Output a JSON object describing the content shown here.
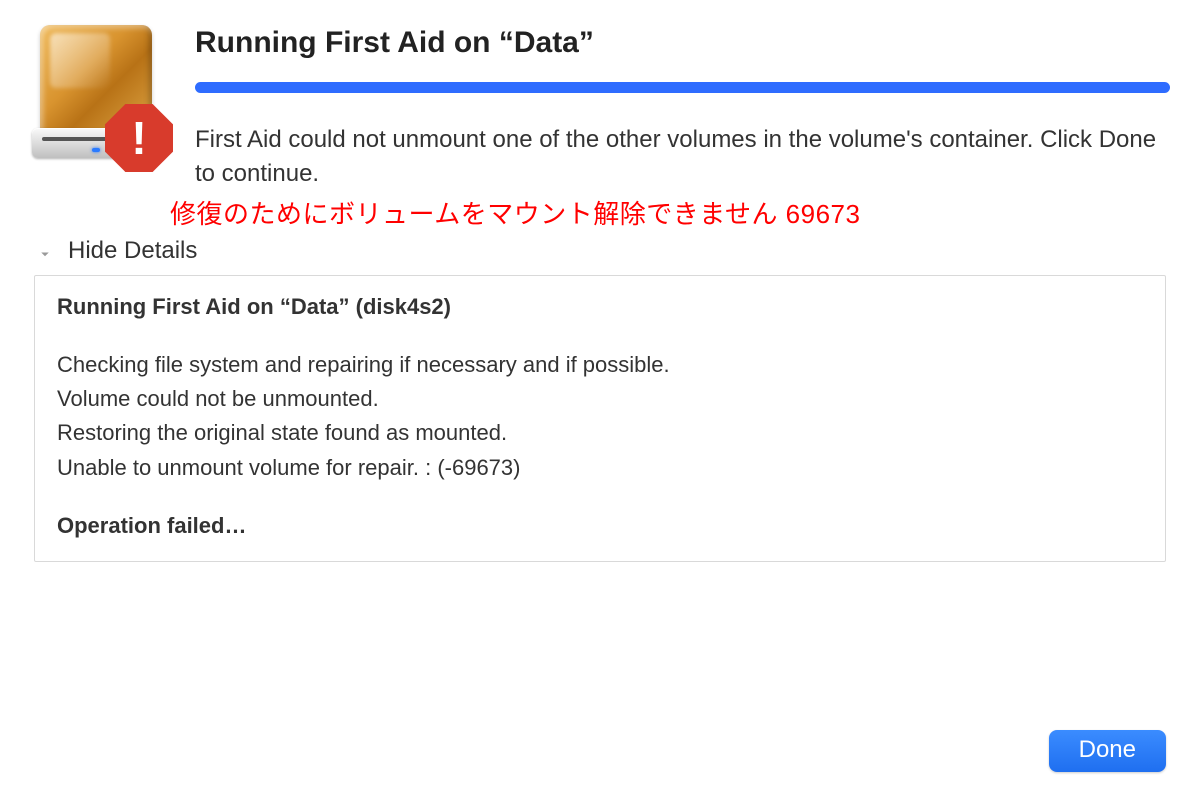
{
  "header": {
    "title": "Running First Aid on “Data”",
    "message": "First Aid could not unmount one of the other volumes in the volume's container. Click Done to continue.",
    "progress_percent": 100
  },
  "annotation": {
    "jp_text": "修復のためにボリュームをマウント解除できません 69673"
  },
  "details": {
    "toggle_label": "Hide Details",
    "heading": "Running First Aid on “Data” (disk4s2)",
    "lines": [
      "Checking file system and repairing if necessary and if possible.",
      "Volume could not be unmounted.",
      "Restoring the original state found as mounted.",
      "Unable to unmount volume for repair. : (-69673)"
    ],
    "result": "Operation failed…"
  },
  "buttons": {
    "done": "Done"
  },
  "colors": {
    "accent": "#2e6cff",
    "error_text": "#ff0000",
    "alert_badge": "#d83b2c"
  }
}
